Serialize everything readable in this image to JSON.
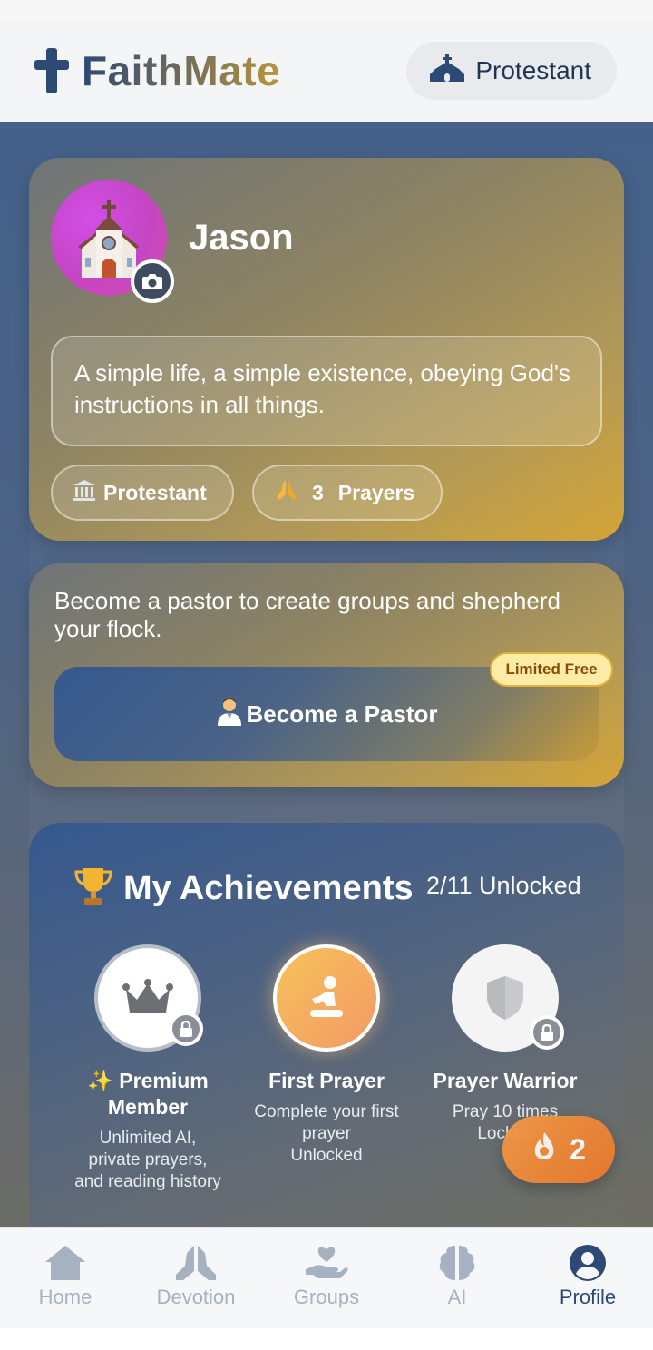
{
  "header": {
    "app_name": "FaithMate",
    "denomination": "Protestant",
    "icon_colors": {
      "brand": "#2c4a74"
    }
  },
  "profile": {
    "name": "Jason",
    "bio": "A simple life, a simple existence, obeying God's instructions in all things.",
    "denomination_chip": "Protestant",
    "prayer_count": "3",
    "prayer_label": "Prayers"
  },
  "pastor": {
    "text": "Become a pastor to create groups and shepherd your flock.",
    "button_label": "Become a Pastor",
    "badge": "Limited Free"
  },
  "achievements": {
    "title": "My Achievements",
    "count": "2/11 Unlocked",
    "items": [
      {
        "name": "✨ Premium Member",
        "desc": "Unlimited AI, private prayers, and reading history",
        "locked": true,
        "icon": "crown-icon"
      },
      {
        "name": "First Prayer",
        "desc": "Complete your first prayer",
        "status": "Unlocked",
        "locked": false,
        "icon": "kneeling-prayer-icon"
      },
      {
        "name": "Prayer Warrior",
        "desc": "Pray 10 times",
        "status": "Locked",
        "locked": true,
        "icon": "shield-icon"
      }
    ]
  },
  "fab": {
    "count": "2",
    "icon": "flame-icon"
  },
  "tabs": [
    {
      "label": "Home",
      "icon": "home-icon"
    },
    {
      "label": "Devotion",
      "icon": "praying-hands-icon"
    },
    {
      "label": "Groups",
      "icon": "heart-hand-icon"
    },
    {
      "label": "AI",
      "icon": "brain-icon"
    },
    {
      "label": "Profile",
      "icon": "user-circle-icon",
      "active": true
    }
  ]
}
